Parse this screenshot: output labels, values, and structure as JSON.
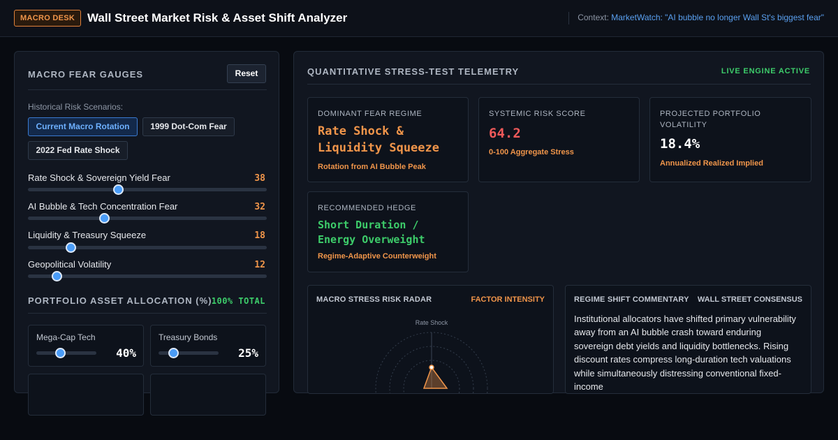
{
  "header": {
    "badge": "MACRO DESK",
    "title": "Wall Street Market Risk & Asset Shift Analyzer",
    "context_label": "Context:",
    "context_link": "MarketWatch: \"AI bubble no longer Wall St's biggest fear\""
  },
  "left": {
    "title": "MACRO FEAR GAUGES",
    "reset_label": "Reset",
    "scenarios_label": "Historical Risk Scenarios:",
    "scenarios": [
      {
        "label": "Current Macro Rotation",
        "active": true
      },
      {
        "label": "1999 Dot-Com Fear",
        "active": false
      },
      {
        "label": "2022 Fed Rate Shock",
        "active": false
      }
    ],
    "gauges": [
      {
        "label": "Rate Shock & Sovereign Yield Fear",
        "value": "38",
        "level": 38
      },
      {
        "label": "AI Bubble & Tech Concentration Fear",
        "value": "32",
        "level": 32
      },
      {
        "label": "Liquidity & Treasury Squeeze",
        "value": "18",
        "level": 18
      },
      {
        "label": "Geopolitical Volatility",
        "value": "12",
        "level": 12
      }
    ],
    "allocation_title": "PORTFOLIO ASSET ALLOCATION (%)",
    "allocation_total": "100% TOTAL",
    "allocations": [
      {
        "name": "Mega-Cap Tech",
        "value": "40%",
        "level": 40
      },
      {
        "name": "Treasury Bonds",
        "value": "25%",
        "level": 25
      }
    ]
  },
  "right": {
    "title": "QUANTITATIVE STRESS-TEST TELEMETRY",
    "status": "LIVE ENGINE ACTIVE",
    "metrics": {
      "regime": {
        "label": "DOMINANT FEAR REGIME",
        "value_line1": "Rate Shock &",
        "value_line2": "Liquidity Squeeze",
        "sub": "Rotation from AI Bubble Peak"
      },
      "risk": {
        "label": "SYSTEMIC RISK SCORE",
        "value": "64.2",
        "sub": "0-100 Aggregate Stress"
      },
      "vol": {
        "label_line1": "PROJECTED PORTFOLIO",
        "label_line2": "VOLATILITY",
        "value": "18.4%",
        "sub": "Annualized Realized Implied"
      },
      "hedge": {
        "label": "RECOMMENDED HEDGE",
        "value_line1": "Short Duration /",
        "value_line2": "Energy Overweight",
        "sub": "Regime-Adaptive Counterweight"
      }
    },
    "radar": {
      "title": "MACRO STRESS RISK RADAR",
      "tag": "FACTOR INTENSITY",
      "axis_top_label": "Rate Shock"
    },
    "commentary": {
      "title": "REGIME SHIFT COMMENTARY",
      "tag": "WALL STREET CONSENSUS",
      "text": "Institutional allocators have shifted primary vulnerability away from an AI bubble crash toward enduring sovereign debt yields and liquidity bottlenecks. Rising discount rates compress long-duration tech valuations while simultaneously distressing conventional fixed-income"
    }
  },
  "colors": {
    "accent_orange": "#f0954a",
    "accent_green": "#3dcc6a",
    "accent_blue": "#4a9cf7",
    "risk_red": "#f05a5a"
  }
}
